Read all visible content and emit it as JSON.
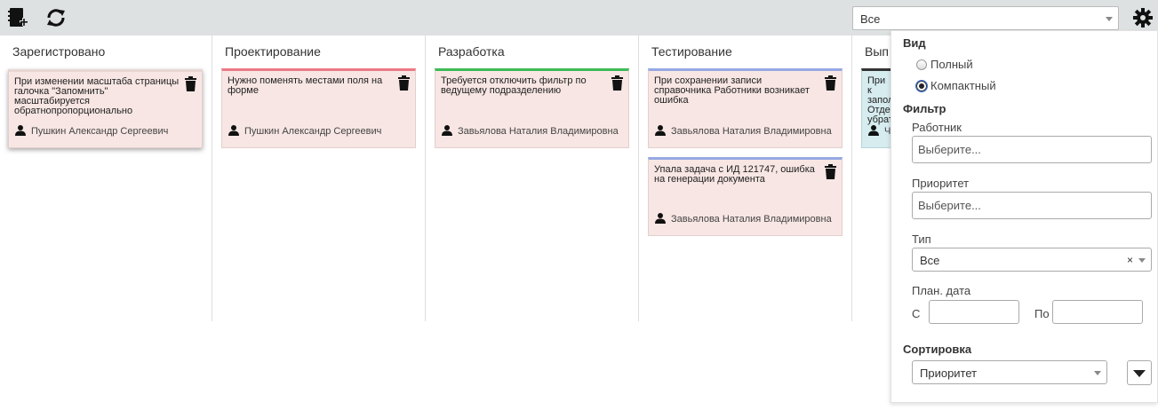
{
  "toolbar": {
    "icons": [
      "notebook-add-icon",
      "refresh-icon",
      "gear-icon"
    ],
    "filter_value": "Все"
  },
  "columns": [
    {
      "title": "Зарегистровано",
      "cards": [
        {
          "text": "При изменении масштаба страницы галочка \"Запомнить\" масштабируется обратнопропорционально",
          "user": "Пушкин Александр Сергеевич",
          "accent": "#e8d6d2"
        }
      ]
    },
    {
      "title": "Проектирование",
      "cards": [
        {
          "text": "Нужно поменять местами поля на форме",
          "user": "Пушкин Александр Сергеевич",
          "accent": "#ec7a87"
        }
      ]
    },
    {
      "title": "Разработка",
      "cards": [
        {
          "text": "Требуется отключить фильтр по ведущему подразделению",
          "user": "Завьялова Наталия Владимировна",
          "accent": "#3dbb57"
        }
      ]
    },
    {
      "title": "Тестирование",
      "cards": [
        {
          "text": "При сохранении записи справочника Работники возникает ошибка",
          "user": "Завьялова Наталия Владимировна",
          "accent": "#96a8e3"
        },
        {
          "text": "Упала задача с ИД 121747, ошибка на генерации документа",
          "user": "Завьялова Наталия Владимировна",
          "accent": "#96a8e3"
        }
      ]
    },
    {
      "title": "Вып",
      "cards": [
        {
          "text": "При к запол Отде убрат",
          "user": "Ч",
          "accent": "#333333"
        }
      ]
    }
  ],
  "panel": {
    "view_title": "Вид",
    "view_options": [
      {
        "label": "Полный",
        "checked": false
      },
      {
        "label": "Компактный",
        "checked": true
      }
    ],
    "filter_title": "Фильтр",
    "worker_label": "Работник",
    "worker_placeholder": "Выберите...",
    "priority_label": "Приоритет",
    "priority_placeholder": "Выберите...",
    "type_label": "Тип",
    "type_value": "Все",
    "type_clear": "×",
    "date_label": "План. дата",
    "date_from_label": "С",
    "date_to_label": "По",
    "sort_title": "Сортировка",
    "sort_value": "Приоритет"
  }
}
